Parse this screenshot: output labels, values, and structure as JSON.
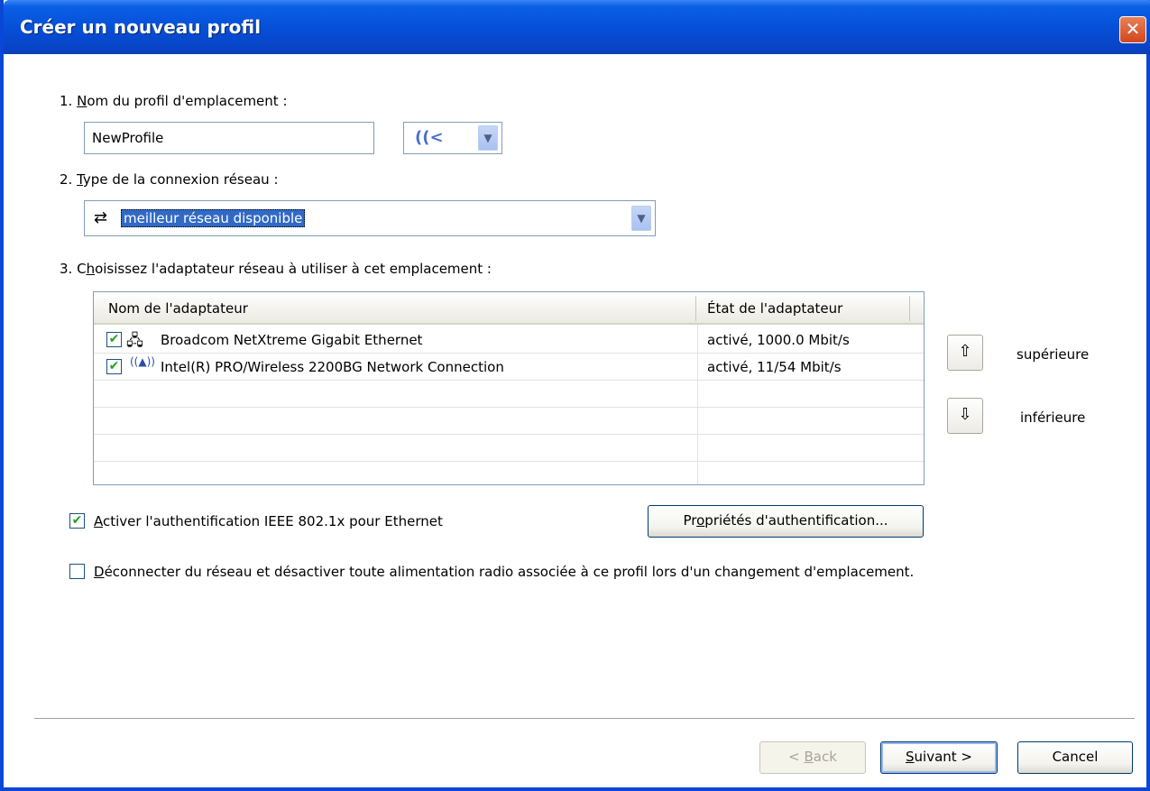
{
  "window": {
    "title": "Créer un nouveau profil",
    "close_glyph": "✕"
  },
  "step1": {
    "num": "1. ",
    "acc": "N",
    "rest": "om du profil d'emplacement :",
    "profile_name_value": "NewProfile",
    "icon_picker_icon": "wireless-icon"
  },
  "step2": {
    "num": "2. ",
    "acc": "T",
    "rest": "ype de la connexion réseau :",
    "selected": "meilleur réseau disponible",
    "icon": "cycle-arrows-icon"
  },
  "step3": {
    "num": "3. C",
    "acc": "h",
    "rest": "oisissez l'adaptateur réseau à utiliser à cet emplacement :",
    "columns": [
      "Nom de l'adaptateur",
      "État de l'adaptateur"
    ],
    "adapters": [
      {
        "checked": true,
        "icon": "network-wired-icon",
        "name": "Broadcom NetXtreme Gigabit Ethernet",
        "status": "activé, 1000.0 Mbit/s"
      },
      {
        "checked": true,
        "icon": "wireless-antenna-icon",
        "name": "Intel(R) PRO/Wireless 2200BG Network Connection",
        "status": "activé, 11/54 Mbit/s"
      }
    ],
    "move_up_label": "supérieure",
    "move_down_label": "inférieure"
  },
  "options": {
    "ieee_acc": "A",
    "ieee_rest": "ctiver l'authentification IEEE 802.1x pour Ethernet",
    "ieee_checked": true,
    "auth_btn_pre": "Pr",
    "auth_btn_acc": "o",
    "auth_btn_rest": "priétés d'authentification...",
    "disconnect_acc": "D",
    "disconnect_rest": "éconnecter du réseau et désactiver toute alimentation radio associée à ce profil lors d'un changement d'emplacement.",
    "disconnect_checked": false
  },
  "footer": {
    "back_pre": "< ",
    "back_acc": "B",
    "back_rest": "ack",
    "next_acc": "S",
    "next_rest": "uivant >",
    "cancel": "Cancel"
  }
}
